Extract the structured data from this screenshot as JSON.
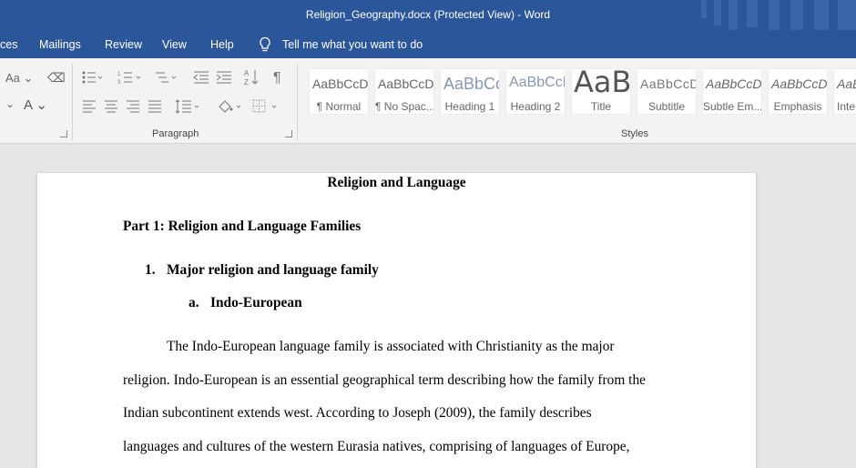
{
  "window": {
    "title": "Religion_Geography.docx (Protected View)  -  Word"
  },
  "menu": {
    "tabs": [
      "ces",
      "Mailings",
      "Review",
      "View",
      "Help"
    ],
    "tell_me": "Tell me what you want to do"
  },
  "ribbon": {
    "groups": {
      "paragraph": "Paragraph",
      "styles": "Styles"
    },
    "font_case_label": "Aa",
    "font_color_label": "A",
    "styles": [
      {
        "preview": "AaBbCcDc",
        "name": "¶ Normal"
      },
      {
        "preview": "AaBbCcDc",
        "name": "¶ No Spac..."
      },
      {
        "preview": "AaBbCc",
        "name": "Heading 1"
      },
      {
        "preview": "AaBbCcD",
        "name": "Heading 2"
      },
      {
        "preview": "AaB",
        "name": "Title"
      },
      {
        "preview": "AaBbCcD",
        "name": "Subtitle"
      },
      {
        "preview": "AaBbCcDc",
        "name": "Subtle Em..."
      },
      {
        "preview": "AaBbCcDc",
        "name": "Emphasis"
      },
      {
        "preview": "AaBbCcDc",
        "name": "Inte"
      }
    ]
  },
  "document": {
    "title": "Religion and Language",
    "part_heading": "Part 1: Religion and Language Families",
    "list1_num": "1.",
    "list1_text": "Major religion and language family",
    "lista_num": "a.",
    "lista_text": "Indo-European",
    "para_lines": [
      "The Indo-European language family is associated with Christianity as the major",
      "religion. Indo-European is an essential geographical term describing how the family from the",
      "Indian subcontinent extends west. According to Joseph (2009), the family describes",
      "languages and cultures of the western Eurasia natives, comprising of languages of Europe,"
    ]
  },
  "colors": {
    "word_blue": "#2b579a",
    "ribbon_bg": "#f3f3f3",
    "canvas_bg": "#e6e6e6"
  }
}
